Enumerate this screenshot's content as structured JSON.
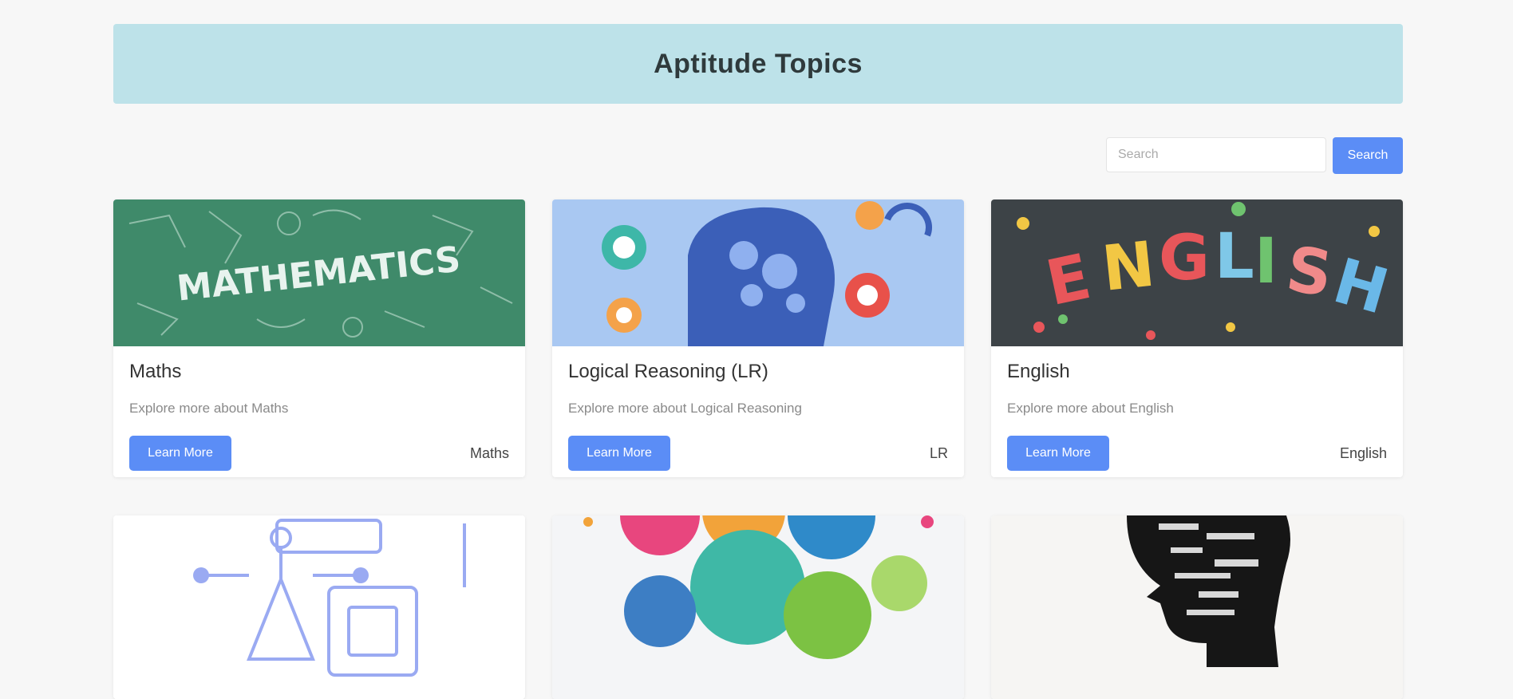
{
  "header": {
    "title": "Aptitude Topics"
  },
  "search": {
    "placeholder": "Search",
    "button_label": "Search"
  },
  "topics": [
    {
      "title": "Maths",
      "description": "Explore more about Maths",
      "button_label": "Learn More",
      "tag": "Maths",
      "image": "maths-chalkboard"
    },
    {
      "title": "Logical Reasoning (LR)",
      "description": "Explore more about Logical Reasoning",
      "button_label": "Learn More",
      "tag": "LR",
      "image": "brain-gears"
    },
    {
      "title": "English",
      "description": "Explore more about English",
      "button_label": "Learn More",
      "tag": "English",
      "image": "english-letters"
    },
    {
      "image": "ai-chip-illustration"
    },
    {
      "image": "colored-icon-circles"
    },
    {
      "image": "head-silhouette-words"
    }
  ],
  "colors": {
    "banner": "#bde2e9",
    "primary_button": "#5b8df6",
    "page_bg": "#f7f7f7"
  }
}
